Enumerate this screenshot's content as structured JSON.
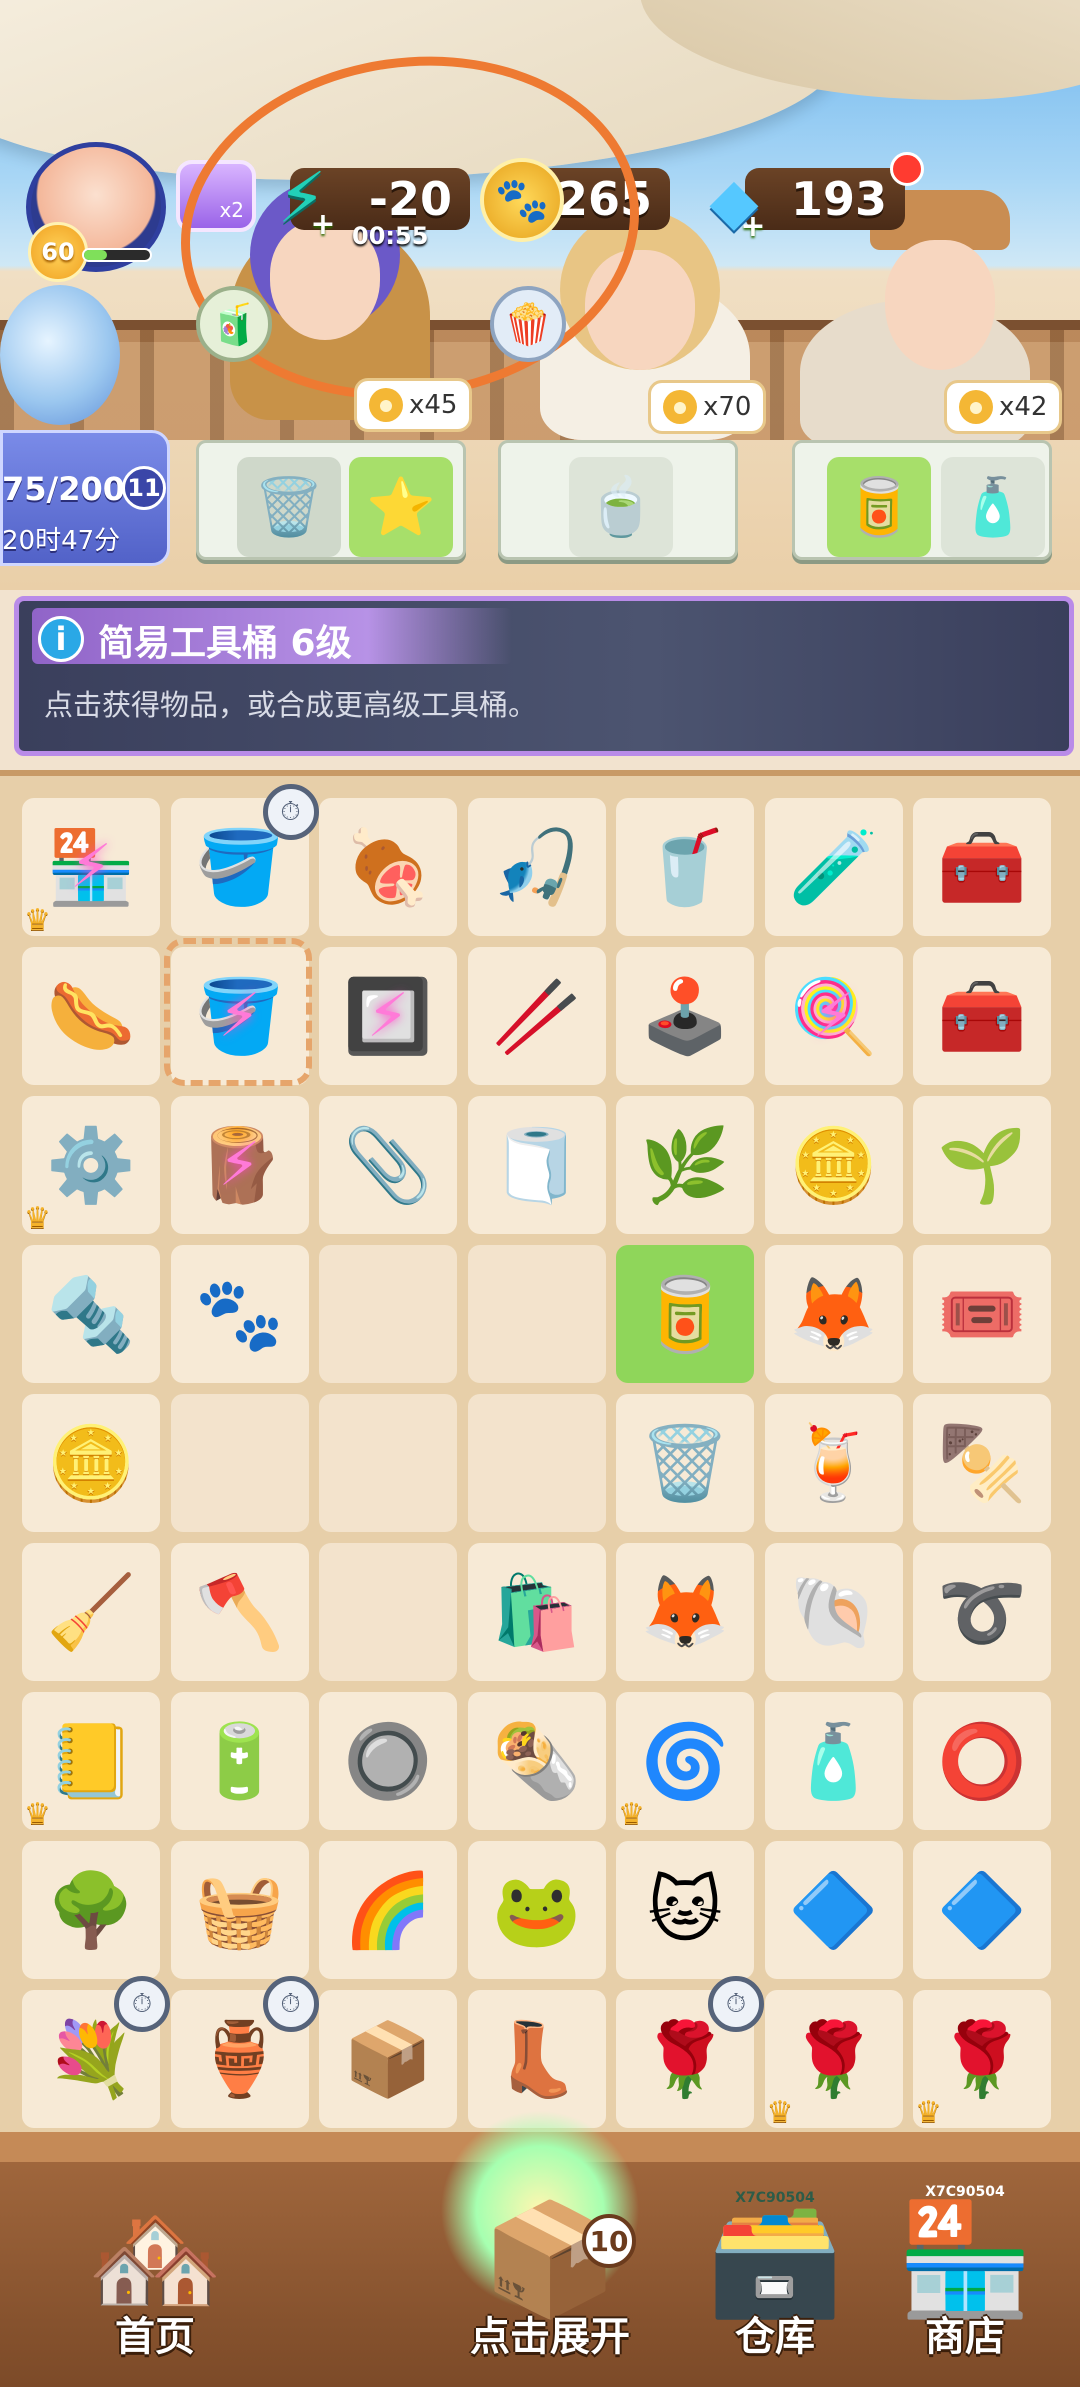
{
  "player": {
    "level": "60",
    "xp_fraction": 0.35,
    "multiplier": "x2"
  },
  "resources": {
    "energy_value": "-20",
    "energy_timer": "00:55",
    "paw_coins": "7265",
    "gems": "193"
  },
  "customers": [
    {
      "reward_count": "x45"
    },
    {
      "reward_count": "x70"
    },
    {
      "reward_count": "x42"
    }
  ],
  "event": {
    "progress": "75/200",
    "level_badge": "11",
    "time_left": "20时47分"
  },
  "tooltip": {
    "title": "简易工具桶 6级",
    "description": "点击获得物品，或合成更高级工具桶。"
  },
  "board": {
    "rows": [
      [
        "gift-shop-icon",
        "tool-bucket-icon",
        "bbq-grill-icon",
        "fishing-rod-icon",
        "vending-machine-icon",
        "mini-shelf-icon",
        "tool-box-icon"
      ],
      [
        "grilled-sausage-icon",
        "tool-bucket-locked-icon",
        "grill-locked-icon",
        "wood-stick-icon",
        "claw-machine-icon",
        "cotton-candy-locked-icon",
        "tool-box-small-icon"
      ],
      [
        "gear-icon",
        "mug-locked-icon",
        "metal-clip-icon",
        "paper-roll-icon",
        "seaweed-icon",
        "gold-bars-icon",
        "green-plant-icon"
      ],
      [
        "screw-icon",
        "paw-coin-pile-icon",
        "",
        "",
        "paint-cans-icon",
        "fox-sticker-icon",
        "lottery-tickets-icon"
      ],
      [
        "coin-stack-icon",
        "",
        "",
        "",
        "trash-can-icon",
        "juice-cup-icon",
        "skewers-icon"
      ],
      [
        "rake-icon",
        "hatchet-icon",
        "",
        "plastic-bag-icon",
        "fox-plush-icon",
        "seashell-icon",
        "rope-icon"
      ],
      [
        "sketchbook-icon",
        "battery-icon",
        "wax-seal-icon",
        "spring-rolls-icon",
        "coiled-rope-icon",
        "detergent-jug-icon",
        "hose-reel-icon"
      ],
      [
        "bonsai-icon",
        "wire-basket-icon",
        "slinky-icon",
        "frog-toy-icon",
        "cat-keychain-icon",
        "glass-tray-icon",
        "glass-trays-icon"
      ],
      [
        "flower-vase-icon",
        "small-vase-icon",
        "crate-icon",
        "boots-icon",
        "rose-pot-icon",
        "rose-planter-icon",
        "rose-planter-large-icon"
      ]
    ]
  },
  "nav": {
    "home": "首页",
    "expand": "点击展开",
    "expand_count": "10",
    "warehouse": "仓库",
    "shop": "商店",
    "warehouse_label": "X7C90504",
    "shop_label": "X7C90504"
  },
  "colors": {
    "accent_purple": "#9a63e8",
    "tooltip_border": "#b98be8",
    "annotation_orange": "#ee7a32"
  }
}
